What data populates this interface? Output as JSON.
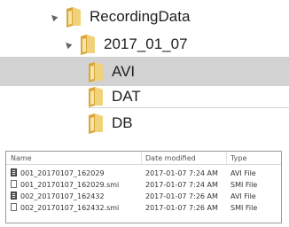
{
  "tree": {
    "items": [
      {
        "label": "RecordingData",
        "expanded": true,
        "selected": false
      },
      {
        "label": "2017_01_07",
        "expanded": true,
        "selected": false
      },
      {
        "label": "AVI",
        "selected": true
      },
      {
        "label": "DAT",
        "selected": false
      },
      {
        "label": "DB",
        "selected": false
      }
    ]
  },
  "file_list": {
    "columns": {
      "name": "Name",
      "date": "Date modified",
      "type": "Type"
    },
    "rows": [
      {
        "name": "001_20170107_162029",
        "date": "2017-01-07 7:24 AM",
        "type": "AVI File",
        "icon": "video-file-icon"
      },
      {
        "name": "001_20170107_162029.smi",
        "date": "2017-01-07 7:24 AM",
        "type": "SMI File",
        "icon": "document-file-icon"
      },
      {
        "name": "002_20170107_162432",
        "date": "2017-01-07 7:26 AM",
        "type": "AVI File",
        "icon": "video-file-icon"
      },
      {
        "name": "002_20170107_162432.smi",
        "date": "2017-01-07 7:26 AM",
        "type": "SMI File",
        "icon": "document-file-icon"
      }
    ]
  },
  "colors": {
    "selected_row": "#d2d2d2",
    "folder": "#e8c25a",
    "border": "#9b9b9b"
  }
}
